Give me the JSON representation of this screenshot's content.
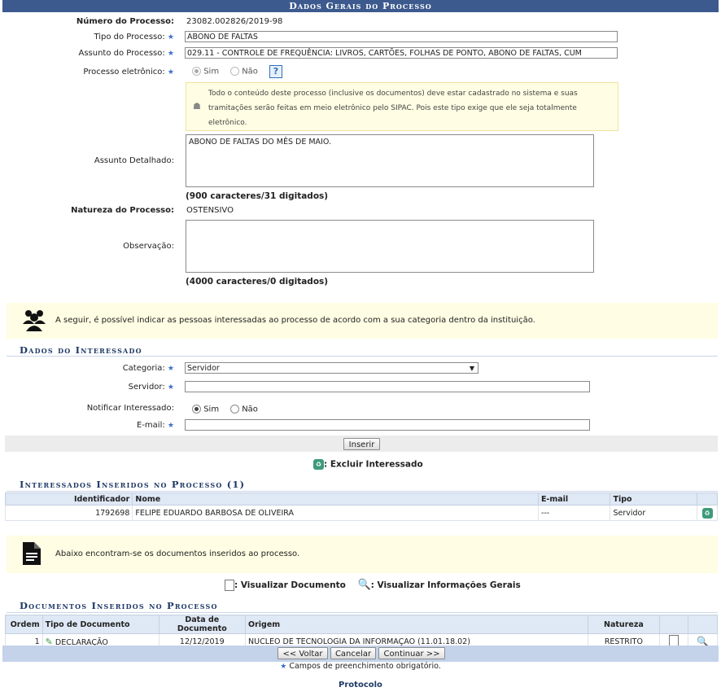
{
  "header": {
    "title": "Dados Gerais do Processo"
  },
  "fields": {
    "numero_label": "Número do Processo:",
    "numero_value": "23082.002826/2019-98",
    "tipo_label": "Tipo do Processo:",
    "tipo_value": "ABONO DE FALTAS",
    "assunto_label": "Assunto do Processo:",
    "assunto_value": "029.11 - CONTROLE DE FREQUÊNCIA: LIVROS, CARTÕES, FOLHAS DE PONTO, ABONO DE FALTAS, CUM",
    "eletronico_label": "Processo eletrônico:",
    "sim": "Sim",
    "nao": "Não",
    "help": "?",
    "eletronico_notice": "Todo o conteúdo deste processo (inclusive os documentos) deve estar cadastrado no sistema e suas tramitações serão feitas em meio eletrônico pelo SIPAC. Pois este tipo exige que ele seja totalmente eletrônico.",
    "detalhado_label": "Assunto Detalhado:",
    "detalhado_value": "ABONO DE FALTAS DO MÊS DE MAIO.",
    "detalhado_counter": "(900 caracteres/31 digitados)",
    "natureza_label": "Natureza do Processo:",
    "natureza_value": "OSTENSIVO",
    "observacao_label": "Observação:",
    "observacao_value": "",
    "observacao_counter": "(4000 caracteres/0 digitados)"
  },
  "interessados_notice": "A seguir, é possível indicar as pessoas interessadas ao processo de acordo com a sua categoria dentro da instituição.",
  "interessado": {
    "title": "Dados do Interessado",
    "categoria_label": "Categoria:",
    "categoria_value": "Servidor",
    "servidor_label": "Servidor:",
    "servidor_value": "",
    "notificar_label": "Notificar Interessado:",
    "sim": "Sim",
    "nao": "Não",
    "email_label": "E-mail:",
    "email_value": "",
    "inserir": "Inserir"
  },
  "excluir_legend": ": Excluir Interessado",
  "interessados_table": {
    "title": "Interessados Inseridos no Processo (1)",
    "headers": [
      "Identificador",
      "Nome",
      "E-mail",
      "Tipo"
    ],
    "rows": [
      {
        "id": "1792698",
        "nome": "FELIPE EDUARDO BARBOSA DE OLIVEIRA",
        "email": "---",
        "tipo": "Servidor"
      }
    ]
  },
  "documentos_notice": "Abaixo encontram-se os documentos inseridos ao processo.",
  "doc_legend": {
    "visualizar_doc": ": Visualizar Documento",
    "visualizar_info": ": Visualizar Informações Gerais"
  },
  "documentos_table": {
    "title": "Documentos Inseridos no Processo",
    "headers": [
      "Ordem",
      "Tipo de Documento",
      "Data de Documento",
      "Origem",
      "Natureza"
    ],
    "rows": [
      {
        "ordem": "1",
        "tipo": "DECLARAÇÃO",
        "data": "12/12/2019",
        "origem": "NUCLEO DE TECNOLOGIA DA INFORMAÇAO (11.01.18.02)",
        "natureza": "RESTRITO"
      }
    ]
  },
  "buttons": {
    "voltar": "<< Voltar",
    "cancelar": "Cancelar",
    "continuar": "Continuar >>"
  },
  "required_note": "Campos de preenchimento obrigatório.",
  "footer": "Protocolo",
  "colors": {
    "header": "#3c5a8e",
    "notice": "#fffde3",
    "required": "#3c6ecc"
  }
}
